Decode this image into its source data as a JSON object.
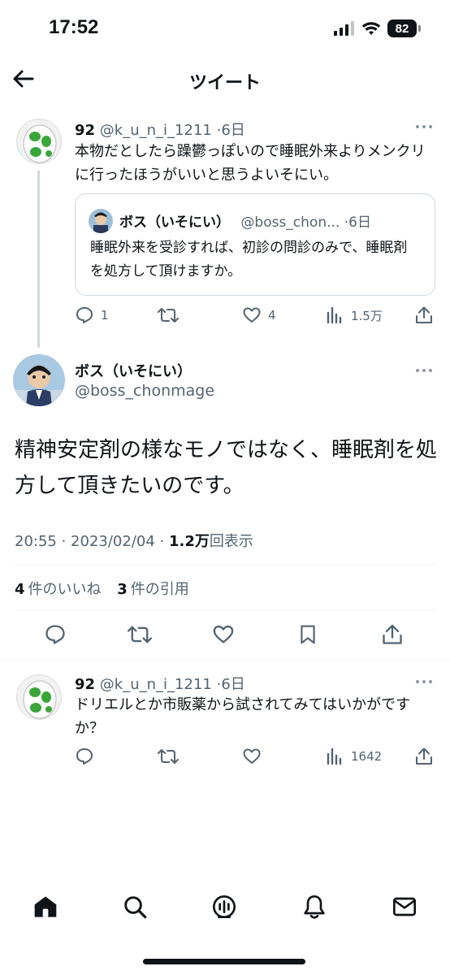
{
  "status_bar": {
    "time": "17:52",
    "battery": "82"
  },
  "header": {
    "title": "ツイート"
  },
  "reply_parent": {
    "name": "92",
    "handle": "@k_u_n_i_1211",
    "time": "·6日",
    "text": "本物だとしたら躁鬱っぽいので睡眠外来よりメンクリに行ったほうがいいと思うよいそにい。",
    "quote": {
      "name": "ボス（いそにい）",
      "handle": "@boss_chon...",
      "time": "·6日",
      "text": "睡眠外来を受診すれば、初診の問診のみで、睡眠剤を処方して頂けますか。"
    },
    "actions": {
      "replies": "1",
      "retweets": "",
      "likes": "4",
      "views": "1.5万"
    }
  },
  "main_tweet": {
    "name": "ボス（いそにい）",
    "handle": "@boss_chonmage",
    "text": "精神安定剤の様なモノではなく、睡眠剤を処方して頂きたいのです。",
    "timestamp": "20:55 · 2023/02/04 · ",
    "views_count": "1.2万",
    "views_label": "回表示",
    "likes_count": "4",
    "likes_label": "件のいいね",
    "quotes_count": "3",
    "quotes_label": "件の引用"
  },
  "reply_child": {
    "name": "92",
    "handle": "@k_u_n_i_1211",
    "time": "·6日",
    "text": "ドリエルとか市販薬から試されてみてはいかがですか？",
    "actions": {
      "views": "1642"
    }
  },
  "colors": {
    "text": "#0f1419",
    "muted": "#536471",
    "border": "#cfd9de"
  }
}
